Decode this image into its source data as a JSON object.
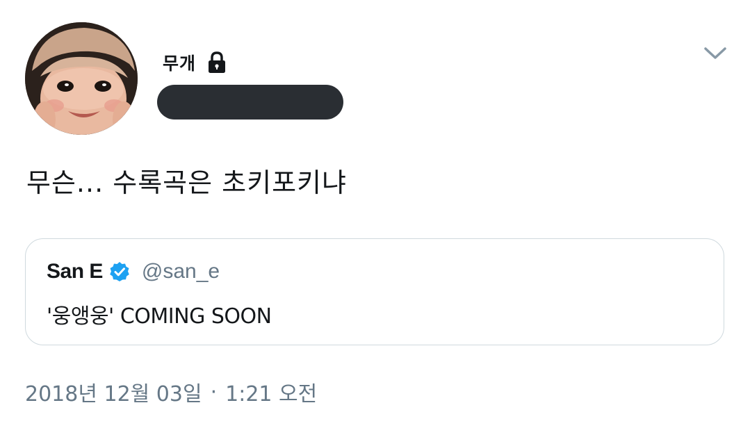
{
  "author": {
    "display_name": "무개",
    "protected_icon": "lock-icon",
    "avatar_icon": "profile-photo"
  },
  "tweet": {
    "text": "무슨... 수록곡은 초키포키냐"
  },
  "quoted_tweet": {
    "name": "San E",
    "verified_icon": "verified-badge-icon",
    "handle": "@san_e",
    "text": "'웅앵웅' COMING SOON"
  },
  "meta": {
    "date": "2018년 12월 03일",
    "separator": "·",
    "time": "1:21 오전"
  },
  "menu": {
    "icon": "chevron-down-icon"
  },
  "colors": {
    "text": "#14171a",
    "secondary": "#657786",
    "verified": "#1da1f2",
    "border": "#cfd9de",
    "redaction": "#2a2e33"
  }
}
